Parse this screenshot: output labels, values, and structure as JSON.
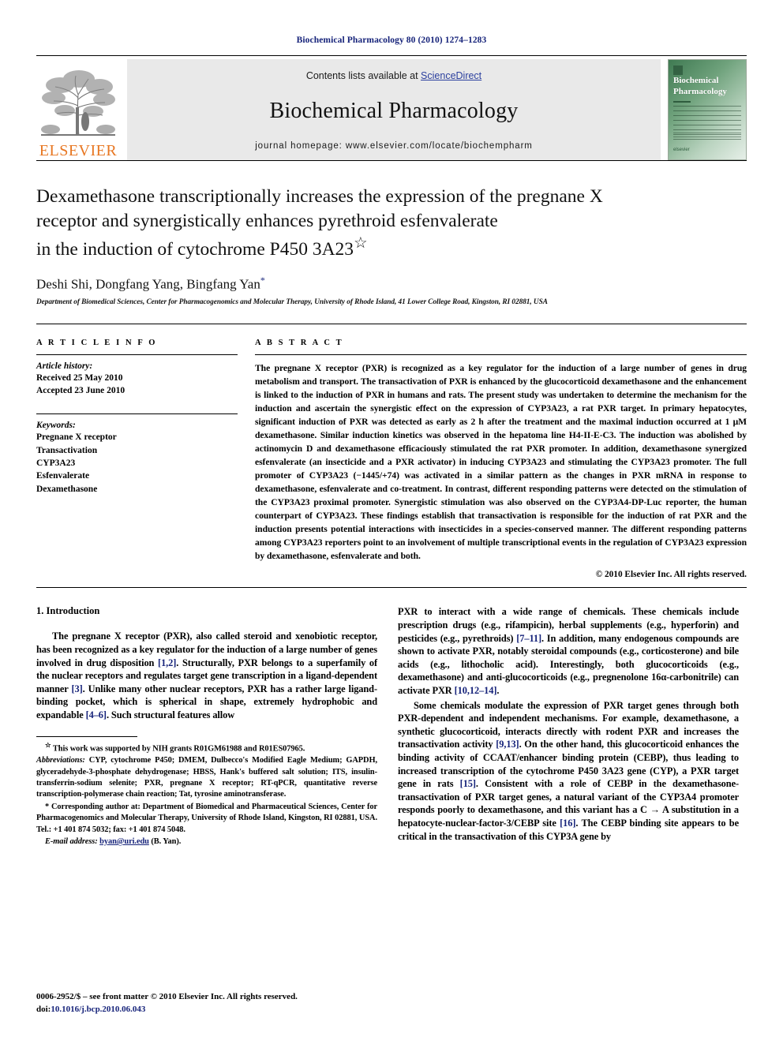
{
  "running_head": "Biochemical Pharmacology 80 (2010) 1274–1283",
  "masthead": {
    "contents_prefix": "Contents lists available at ",
    "sciencedirect": "ScienceDirect",
    "journal_title": "Biochemical Pharmacology",
    "homepage": "journal homepage: www.elsevier.com/locate/biochempharm",
    "publisher_wordmark": "ELSEVIER",
    "cover_title_line1": "Biochemical",
    "cover_title_line2": "Pharmacology",
    "cover_publisher": "elsevier",
    "accent_orange": "#e87722",
    "link_blue": "#2b3f9e",
    "band_gray": "#e9e9e9"
  },
  "title": {
    "line1": "Dexamethasone transcriptionally increases the expression of the pregnane X",
    "line2": "receptor and synergistically enhances pyrethroid esfenvalerate",
    "line3": "in the induction of cytochrome P450 3A23",
    "footnote_marker": "☆"
  },
  "authors": {
    "names": "Deshi Shi, Dongfang Yang, Bingfang Yan",
    "corresponding_marker": "*",
    "affiliation": "Department of Biomedical Sciences, Center for Pharmacogenomics and Molecular Therapy, University of Rhode Island, 41 Lower College Road, Kingston, RI 02881, USA"
  },
  "article_info": {
    "heading": "A R T I C L E   I N F O",
    "history_label": "Article history:",
    "received": "Received 25 May 2010",
    "accepted": "Accepted 23 June 2010",
    "keywords_label": "Keywords:",
    "keywords": [
      "Pregnane X receptor",
      "Transactivation",
      "CYP3A23",
      "Esfenvalerate",
      "Dexamethasone"
    ]
  },
  "abstract": {
    "heading": "A B S T R A C T",
    "text": "The pregnane X receptor (PXR) is recognized as a key regulator for the induction of a large number of genes in drug metabolism and transport. The transactivation of PXR is enhanced by the glucocorticoid dexamethasone and the enhancement is linked to the induction of PXR in humans and rats. The present study was undertaken to determine the mechanism for the induction and ascertain the synergistic effect on the expression of CYP3A23, a rat PXR target. In primary hepatocytes, significant induction of PXR was detected as early as 2 h after the treatment and the maximal induction occurred at 1 μM dexamethasone. Similar induction kinetics was observed in the hepatoma line H4-II-E-C3. The induction was abolished by actinomycin D and dexamethasone efficaciously stimulated the rat PXR promoter. In addition, dexamethasone synergized esfenvalerate (an insecticide and a PXR activator) in inducing CYP3A23 and stimulating the CYP3A23 promoter. The full promoter of CYP3A23 (−1445/+74) was activated in a similar pattern as the changes in PXR mRNA in response to dexamethasone, esfenvalerate and co-treatment. In contrast, different responding patterns were detected on the stimulation of the CYP3A23 proximal promoter. Synergistic stimulation was also observed on the CYP3A4-DP-Luc reporter, the human counterpart of CYP3A23. These findings establish that transactivation is responsible for the induction of rat PXR and the induction presents potential interactions with insecticides in a species-conserved manner. The different responding patterns among CYP3A23 reporters point to an involvement of multiple transcriptional events in the regulation of CYP3A23 expression by dexamethasone, esfenvalerate and both.",
    "copyright": "© 2010 Elsevier Inc. All rights reserved."
  },
  "introduction": {
    "heading": "1.  Introduction",
    "para1_a": "The pregnane X receptor (PXR), also called steroid and xenobiotic receptor, has been recognized as a key regulator for the induction of a large number of genes involved in drug disposition ",
    "para1_ref1": "[1,2]",
    "para1_b": ". Structurally, PXR belongs to a superfamily of the nuclear receptors and regulates target gene transcription in a ligand-dependent manner ",
    "para1_ref2": "[3]",
    "para1_c": ". Unlike many other nuclear receptors, PXR has a rather large ligand-binding pocket, which is spherical in shape, extremely hydrophobic and expandable ",
    "para1_ref3": "[4–6]",
    "para1_d": ". Such structural features allow",
    "para2_a": "PXR to interact with a wide range of chemicals. These chemicals include prescription drugs (e.g., rifampicin), herbal supplements (e.g., hyperforin) and pesticides (e.g., pyrethroids) ",
    "para2_ref1": "[7–11]",
    "para2_b": ". In addition, many endogenous compounds are shown to activate PXR, notably steroidal compounds (e.g., corticosterone) and bile acids (e.g., lithocholic acid). Interestingly, both glucocorticoids (e.g., dexamethasone) and anti-glucocorticoids (e.g., pregnenolone 16α-carbonitrile) can activate PXR ",
    "para2_ref2": "[10,12–14]",
    "para2_c": ".",
    "para3_a": "Some chemicals modulate the expression of PXR target genes through both PXR-dependent and independent mechanisms. For example, dexamethasone, a synthetic glucocorticoid, interacts directly with rodent PXR and increases the transactivation activity ",
    "para3_ref1": "[9,13]",
    "para3_b": ". On the other hand, this glucocorticoid enhances the binding activity of CCAAT/enhancer binding protein (CEBP), thus leading to increased transcription of the cytochrome P450 3A23 gene (CYP), a PXR target gene in rats ",
    "para3_ref2": "[15]",
    "para3_c": ". Consistent with a role of CEBP in the dexamethasone-transactivation of PXR target genes, a natural variant of the CYP3A4 promoter responds poorly to dexamethasone, and this variant has a C → A substitution in a hepatocyte-nuclear-factor-3/CEBP site ",
    "para3_ref3": "[16]",
    "para3_d": ". The CEBP binding site appears to be critical in the transactivation of this CYP3A gene by"
  },
  "footnotes": {
    "grant_marker": "☆",
    "grant": " This work was supported by NIH grants R01GM61988 and R01ES07965.",
    "abbrev_label": "Abbreviations:",
    "abbrev": " CYP, cytochrome P450; DMEM, Dulbecco's Modified Eagle Medium; GAPDH, glyceradehyde-3-phosphate dehydrogenase; HBSS, Hank's buffered salt solution; ITS, insulin-transferrin-sodium selenite; PXR, pregnane X receptor; RT-qPCR, quantitative reverse transcription-polymerase chain reaction; Tat, tyrosine aminotransferase.",
    "corr_marker": "*",
    "corresponding": " Corresponding author at: Department of Biomedical and Pharmaceutical Sciences, Center for Pharmacogenomics and Molecular Therapy, University of Rhode Island, Kingston, RI 02881, USA. Tel.: +1 401 874 5032; fax: +1 401 874 5048.",
    "email_label": "E-mail address:",
    "email": "byan@uri.edu",
    "email_suffix": " (B. Yan)."
  },
  "imprint": {
    "line1": "0006-2952/$ – see front matter © 2010 Elsevier Inc. All rights reserved.",
    "doi_label": "doi:",
    "doi": "10.1016/j.bcp.2010.06.043"
  }
}
